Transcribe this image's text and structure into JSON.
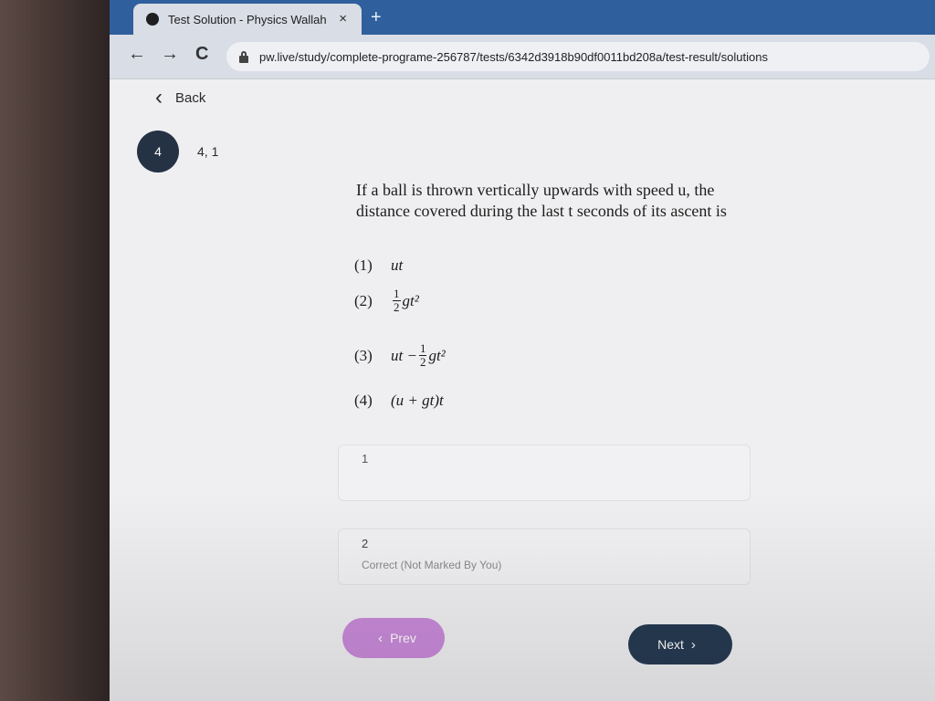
{
  "browser": {
    "tab_title": "Test Solution - Physics Wallah",
    "tab_close": "×",
    "new_tab": "+",
    "back": "←",
    "forward": "→",
    "reload": "C",
    "url": "pw.live/study/complete-programe-256787/tests/6342d3918b90df0011bd208a/test-result/solutions"
  },
  "page": {
    "back_chevron": "‹",
    "back_label": "Back",
    "question_number": "4",
    "marks": "4, 1",
    "question_text": "If a ball is thrown vertically upwards with speed u, the distance covered during the last t seconds of its ascent is",
    "options": [
      {
        "num": "(1)",
        "expr": "ut"
      },
      {
        "num": "(2)",
        "expr_frac_num": "1",
        "expr_frac_den": "2",
        "expr_tail": "gt²"
      },
      {
        "num": "(3)",
        "expr_head": "ut −",
        "expr_frac_num": "1",
        "expr_frac_den": "2",
        "expr_tail": "gt²"
      },
      {
        "num": "(4)",
        "expr": "(u + gt)t"
      }
    ],
    "answer_label_1": "1",
    "answer_label_2": "2",
    "answer_status": "Correct (Not Marked By You)",
    "prev_label": "Prev",
    "next_label": "Next",
    "prev_chevron": "‹",
    "next_chevron": "›"
  },
  "colors": {
    "tab_strip": "#2f5f9c",
    "badge": "#243244",
    "prev_button": "#c98ad9",
    "next_button": "#263a52"
  }
}
